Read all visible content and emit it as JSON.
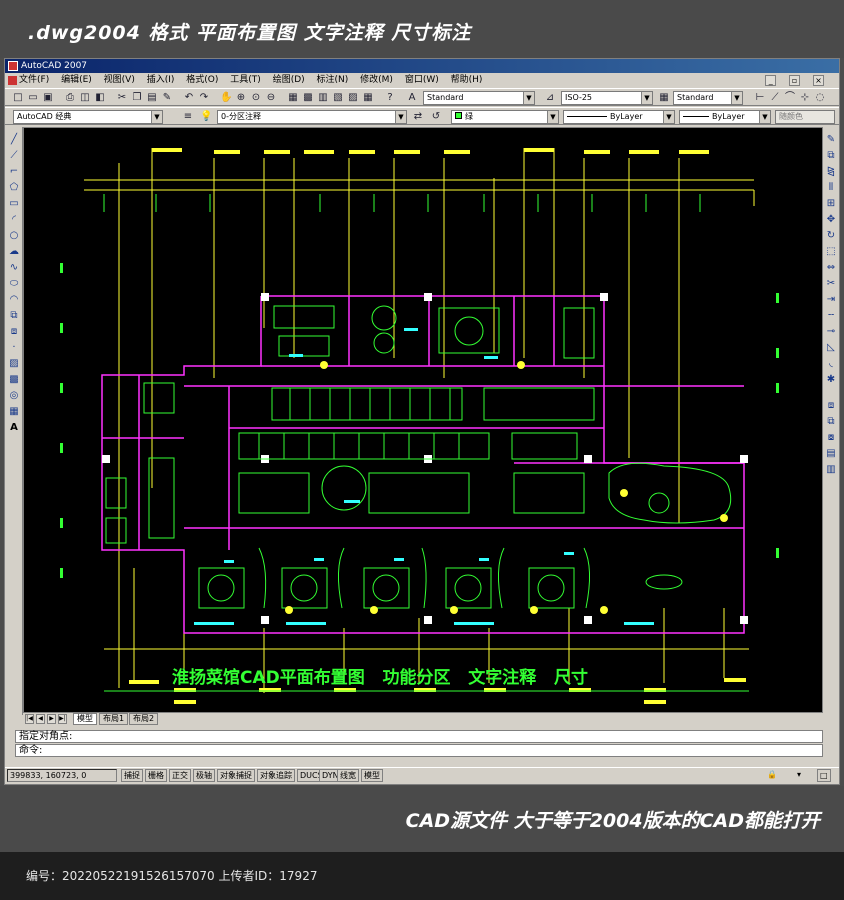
{
  "banner_top": {
    "text": ".dwg2004 格式  平面布置图 文字注释 尺寸标注"
  },
  "window": {
    "title": "AutoCAD 2007",
    "menu": [
      "文件(F)",
      "编辑(E)",
      "视图(V)",
      "插入(I)",
      "格式(O)",
      "工具(T)",
      "绘图(D)",
      "标注(N)",
      "修改(M)",
      "窗口(W)",
      "帮助(H)"
    ],
    "controls": [
      "_",
      "▫",
      "×"
    ]
  },
  "toolbar": {
    "text_style": "Standard",
    "dim_style": "ISO-25",
    "table_style": "Standard",
    "workspace": "AutoCAD 经典",
    "layer": "0-分区注释",
    "color": "绿",
    "linetype": "ByLayer",
    "lineweight": "ByLayer",
    "plot_style": "随颜色"
  },
  "canvas": {
    "caption": "淮扬菜馆CAD平面布置图   功能分区   文字注释   尺寸"
  },
  "tabs": {
    "model": "模型",
    "layout1": "布局1",
    "layout2": "布局2"
  },
  "command": {
    "line1": "指定对角点:",
    "line2": "命令:"
  },
  "status": {
    "coords": "399833, 160723, 0",
    "buttons": [
      "捕捉",
      "栅格",
      "正交",
      "极轴",
      "对象捕捉",
      "对象追踪",
      "DUCS",
      "DYN",
      "线宽",
      "模型"
    ]
  },
  "banner_bottom": {
    "text": "CAD源文件  大于等于2004版本的CAD都能打开"
  },
  "footer": {
    "text": "编号：20220522191526157070 上传者ID：17927"
  },
  "colors": {
    "wall": "#ff33ff",
    "furniture": "#33ff33",
    "dimension": "#ffff33",
    "text_cyan": "#33ffff",
    "highlight": "#ffffff"
  }
}
